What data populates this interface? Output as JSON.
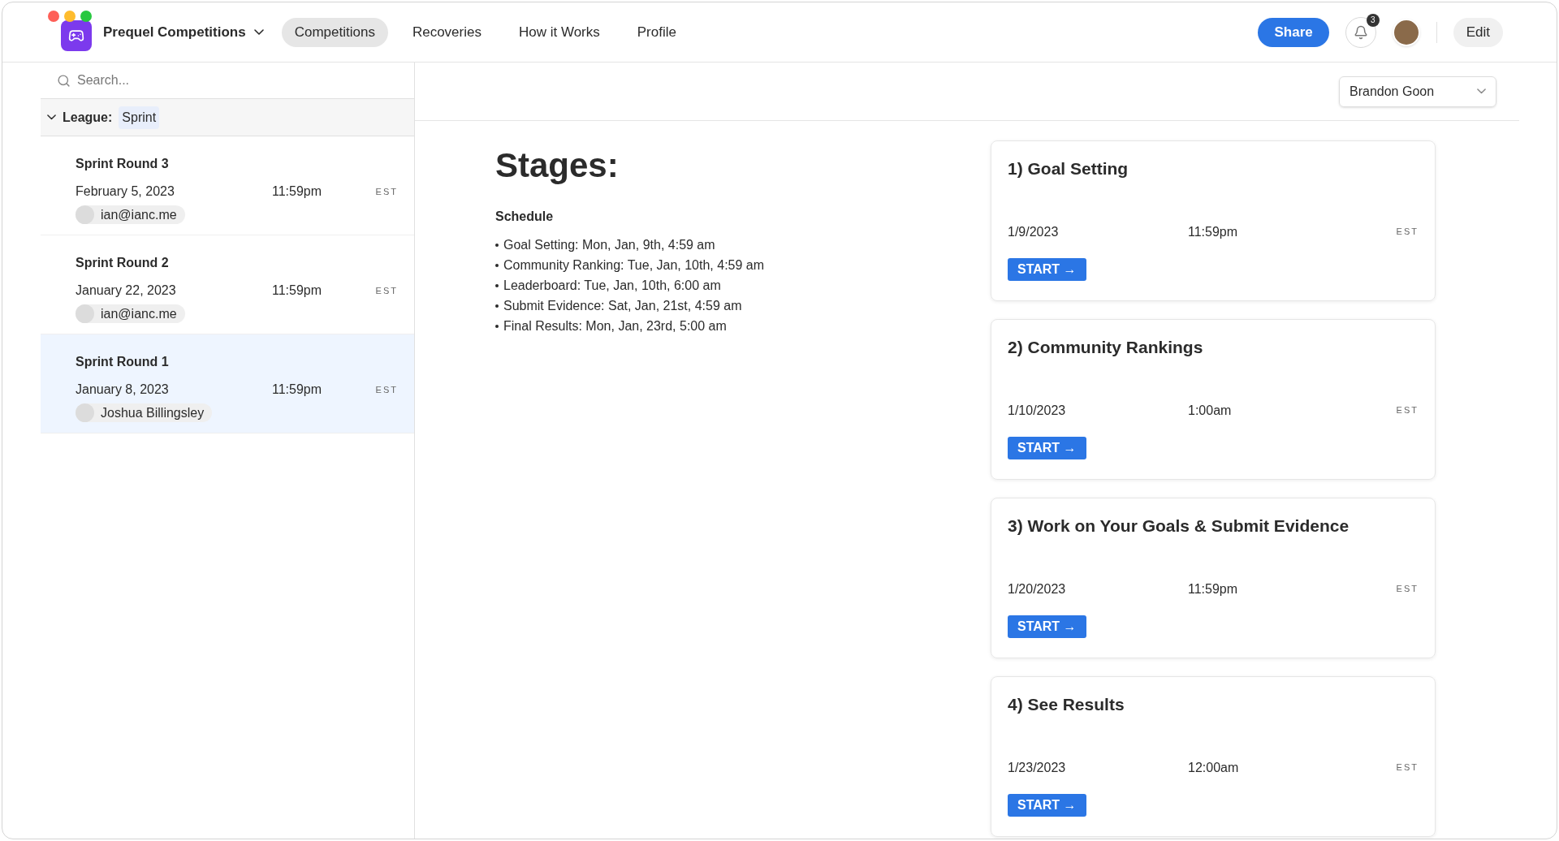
{
  "app": {
    "title": "Prequel Competitions"
  },
  "nav": [
    {
      "label": "Competitions",
      "selected": true
    },
    {
      "label": "Recoveries",
      "selected": false
    },
    {
      "label": "How it Works",
      "selected": false
    },
    {
      "label": "Profile",
      "selected": false
    }
  ],
  "actions": {
    "share": "Share",
    "notification_count": "3",
    "edit": "Edit"
  },
  "sidebar": {
    "search": {
      "placeholder": "Search..."
    },
    "group": {
      "label": "League:",
      "value": "Sprint",
      "expanded": true
    },
    "rounds": [
      {
        "title": "Sprint Round 3",
        "date": "February 5, 2023",
        "time": "11:59pm",
        "zone": "EST",
        "owner": "ian@ianc.me",
        "selected": false
      },
      {
        "title": "Sprint Round 2",
        "date": "January 22, 2023",
        "time": "11:59pm",
        "zone": "EST",
        "owner": "ian@ianc.me",
        "selected": false
      },
      {
        "title": "Sprint Round 1",
        "date": "January 8, 2023",
        "time": "11:59pm",
        "zone": "EST",
        "owner": "Joshua Billingsley",
        "selected": true
      }
    ]
  },
  "user_select": {
    "value": "Brandon Goon"
  },
  "stages": {
    "heading": "Stages:",
    "schedule_title": "Schedule",
    "schedule": [
      "Goal Setting: Mon, Jan, 9th, 4:59 am",
      "Community Ranking: Tue, Jan, 10th, 4:59 am",
      "Leaderboard: Tue, Jan, 10th, 6:00 am",
      "Submit Evidence: Sat, Jan, 21st, 4:59 am",
      "Final Results: Mon, Jan, 23rd, 5:00 am"
    ],
    "cards": [
      {
        "title": "1) Goal Setting",
        "date": "1/9/2023",
        "time": "11:59pm",
        "zone": "EST",
        "button": "START →"
      },
      {
        "title": "2) Community Rankings",
        "date": "1/10/2023",
        "time": "1:00am",
        "zone": "EST",
        "button": "START →"
      },
      {
        "title": "3) Work on Your Goals & Submit Evidence",
        "date": "1/20/2023",
        "time": "11:59pm",
        "zone": "EST",
        "button": "START →"
      },
      {
        "title": "4) See Results",
        "date": "1/23/2023",
        "time": "12:00am",
        "zone": "EST",
        "button": "START →"
      }
    ]
  }
}
